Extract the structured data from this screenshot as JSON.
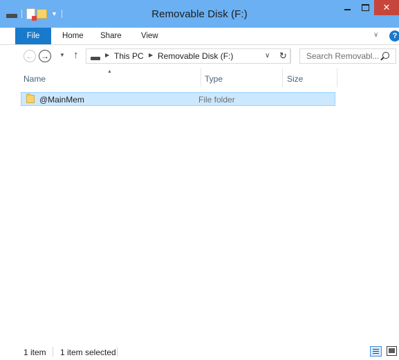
{
  "window": {
    "title": "Removable Disk (F:)",
    "close_glyph": "✕"
  },
  "quick_access": {
    "icons": [
      "drive-icon",
      "properties-icon",
      "new-folder-icon"
    ],
    "dropdown_glyph": "▼"
  },
  "ribbon": {
    "tabs": [
      {
        "label": "File",
        "active": true
      },
      {
        "label": "Home"
      },
      {
        "label": "Share"
      },
      {
        "label": "View"
      }
    ],
    "expand_glyph": "∨",
    "help_glyph": "?"
  },
  "navigation": {
    "back_glyph": "←",
    "forward_glyph": "→",
    "recent_glyph": "▼",
    "up_glyph": "↑",
    "breadcrumbs": [
      "This PC",
      "Removable Disk (F:)"
    ],
    "breadcrumb_sep": "▶",
    "dropdown_glyph": "∨",
    "refresh_glyph": "↻"
  },
  "search": {
    "placeholder": "Search Removabl..."
  },
  "columns": {
    "name": "Name",
    "type": "Type",
    "size": "Size",
    "sort_glyph": "▲"
  },
  "files": [
    {
      "name": "@MainMem",
      "type": "File folder",
      "size": "",
      "selected": true
    }
  ],
  "status": {
    "item_count": "1 item",
    "selection": "1 item selected"
  },
  "colors": {
    "titlebar": "#6ab0f2",
    "file_tab": "#1979ca",
    "close_button": "#c7463b",
    "selection": "#cce8ff"
  }
}
